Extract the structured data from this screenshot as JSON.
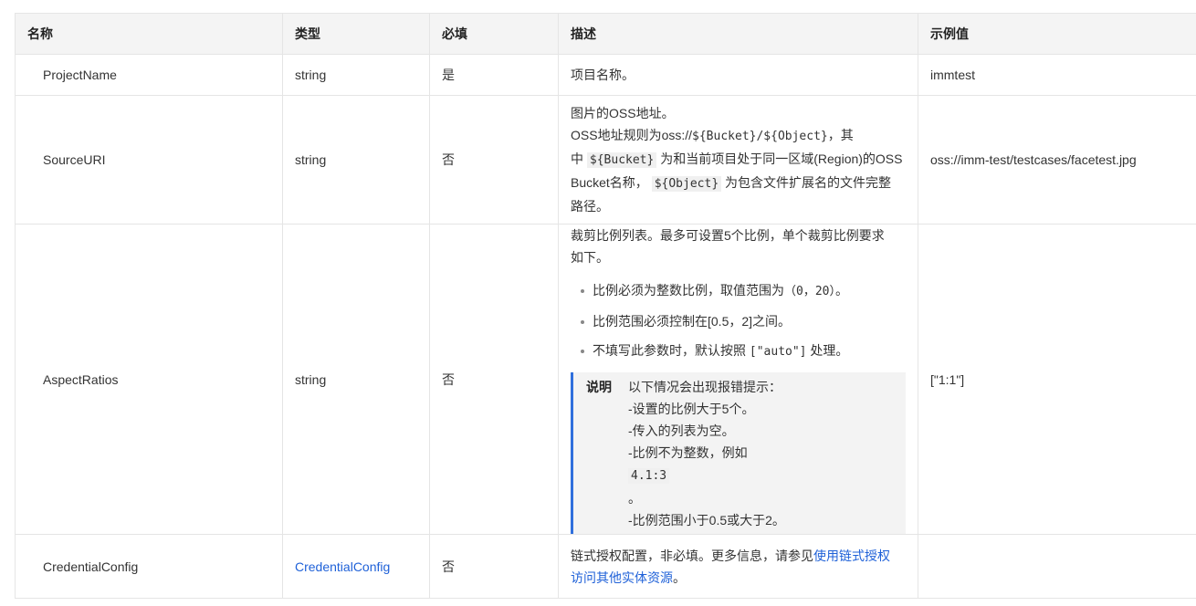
{
  "headers": {
    "name": "名称",
    "type": "类型",
    "required": "必填",
    "description": "描述",
    "example": "示例值"
  },
  "rows": [
    {
      "name": "ProjectName",
      "type": "string",
      "required": "是",
      "description": "项目名称。",
      "example": "immtest"
    },
    {
      "name": "SourceURI",
      "type": "string",
      "required": "否",
      "desc_line1": "图片的OSS地址。",
      "desc_line2_prefix": "OSS地址规则为oss://",
      "desc_line2_code": "${Bucket}/${Object}",
      "desc_line2_suffix": "，其",
      "desc_line3_prefix": "中 ",
      "desc_code_bucket": "${Bucket}",
      "desc_line3_suffix": " 为和当前项目处于同一区域(Region)的OSS",
      "desc_line4_prefix": "Bucket名称，",
      "desc_code_object": "${Object}",
      "desc_line4_suffix": " 为包含文件扩展名的文件完整",
      "desc_line5": "路径。",
      "example": "oss://imm-test/testcases/facetest.jpg"
    },
    {
      "name": "AspectRatios",
      "type": "string",
      "required": "否",
      "desc_intro_1": "裁剪比例列表。最多可设置5个比例，单个裁剪比例要求",
      "desc_intro_2": "如下。",
      "bullet1_prefix": "比例必须为整数比例，取值范围为",
      "bullet1_code": "（0，20）",
      "bullet1_suffix": "。",
      "bullet2": "比例范围必须控制在[0.5，2]之间。",
      "bullet3_prefix": "不填写此参数时，默认按照",
      "bullet3_code": "[\"auto\"]",
      "bullet3_suffix": " 处理。",
      "note_label": "说明",
      "note_line1": "以下情况会出现报错提示：",
      "note_line2": "-设置的比例大于5个。",
      "note_line3": "-传入的列表为空。",
      "note_line4_prefix": "-比例不为整数，例如",
      "note_line4_code": "4.1:3",
      "note_line4_suffix": " 。",
      "note_line5": "-比例范围小于0.5或大于2。",
      "example": "[\"1:1\"]"
    },
    {
      "name": "CredentialConfig",
      "type_link": "CredentialConfig",
      "required": "否",
      "desc_prefix": "链式授权配置，非必填。更多信息，请参见",
      "desc_link_1": "使用链式授权",
      "desc_link_2": "访问其他实体资源",
      "desc_suffix": "。",
      "example": ""
    }
  ],
  "colors": {
    "link": "#1f61d8",
    "note_border": "#2f6fdc",
    "header_bg": "#f4f4f4"
  }
}
